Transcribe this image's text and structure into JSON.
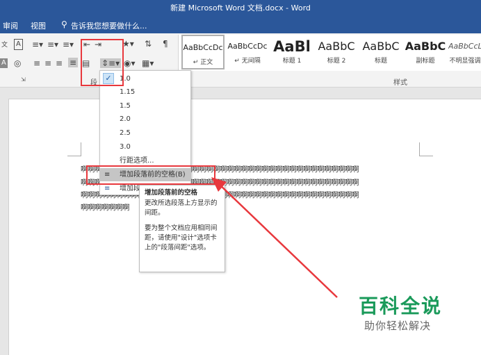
{
  "window": {
    "title": "新建 Microsoft Word 文档.docx - Word"
  },
  "tabs": {
    "review": "审阅",
    "view": "视图",
    "tell_me": "告诉我您想要做什么..."
  },
  "ribbon": {
    "paragraph_group_label": "段",
    "styles_group_label": "样式",
    "styles": [
      {
        "sample": "AaBbCcDc",
        "name": "↵ 正文"
      },
      {
        "sample": "AaBbCcDc",
        "name": "↵ 无间隔"
      },
      {
        "sample": "AaBl",
        "name": "标题 1"
      },
      {
        "sample": "AaBbC",
        "name": "标题 2"
      },
      {
        "sample": "AaBbC",
        "name": "标题"
      },
      {
        "sample": "AaBbC",
        "name": "副标题"
      },
      {
        "sample": "AaBbCcL",
        "name": "不明显强调"
      }
    ]
  },
  "line_spacing_menu": {
    "options": [
      "1.0",
      "1.15",
      "1.5",
      "2.0",
      "2.5",
      "3.0"
    ],
    "selected": "1.0",
    "line_spacing_options": "行距选项...",
    "add_space_before": "增加段落前的空格(B)",
    "add_space_after": "增加段"
  },
  "tooltip": {
    "title": "增加段落前的空格",
    "desc": "更改所选段落上方显示的间距。",
    "note": "要为整个文档应用相同间距，请使用\"设计\"选项卡上的\"段落间距\"选项。"
  },
  "document": {
    "lines": [
      "啊啊啊啊啊啊啊啊啊啊啊啊啊啊啊啊啊啊啊啊啊啊啊啊啊啊啊啊啊啊啊啊啊啊啊啊啊啊啊啊",
      "啊啊啊啊啊啊啊啊啊啊啊啊啊啊啊啊啊啊啊啊啊啊啊啊啊啊啊啊啊啊啊啊啊啊啊啊啊啊啊啊",
      "啊啊啊啊啊啊啊啊啊啊啊啊啊啊啊啊啊啊啊啊啊啊啊啊啊啊啊啊啊啊啊啊啊啊啊啊啊啊啊啊",
      "啊啊啊啊啊啊啊"
    ]
  },
  "watermark": {
    "title": "百科全说",
    "subtitle": "助你轻松解决"
  },
  "colors": {
    "word_blue": "#2b579a",
    "highlight_red": "#e8383d",
    "watermark_green": "#1a9a5a"
  }
}
